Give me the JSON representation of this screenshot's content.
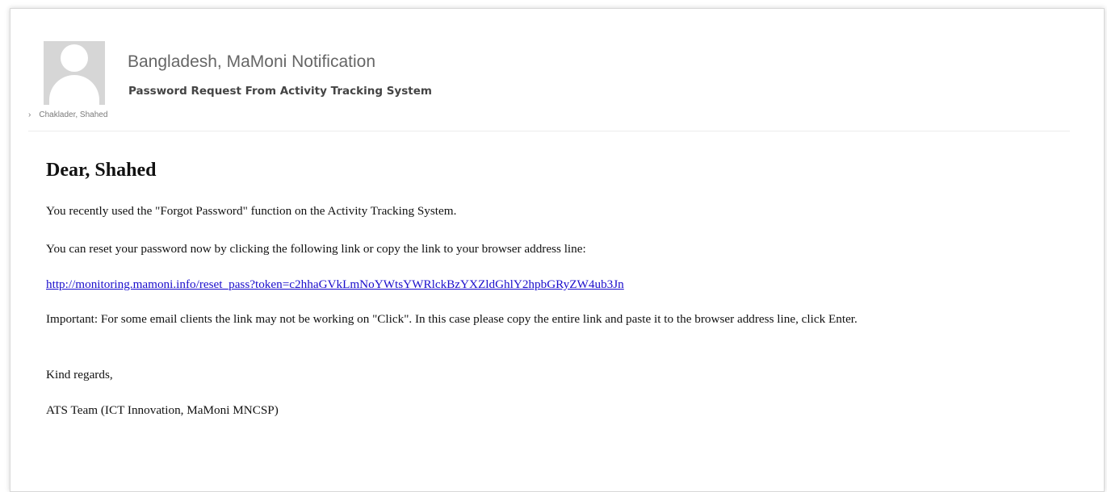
{
  "email": {
    "sender_name": "Bangladesh, MaMoni Notification",
    "subject": "Password Request From Activity Tracking System",
    "recipient": "Chaklader, Shahed",
    "greeting": "Dear, Shahed",
    "paragraphs": [
      "You recently used the \"Forgot Password\" function on the Activity Tracking System.",
      "You can reset your password now by clicking the following link or copy the link to your browser address line:"
    ],
    "reset_link": "http://monitoring.mamoni.info/reset_pass?token=c2hhaGVkLmNoYWtsYWRlckBzYXZldGhlY2hpbGRyZW4ub3Jn",
    "important_note": "Important: For some email clients the link may not be working on \"Click\". In this case please copy the entire link and paste it to the browser address line, click Enter.",
    "closing": "Kind regards,",
    "signature": "ATS Team (ICT Innovation, MaMoni MNCSP)"
  },
  "icons": {
    "avatar": "person-placeholder-icon",
    "recipient_prefix": "chevron-right-icon"
  },
  "colors": {
    "link": "#1a0dcc",
    "avatar_bg": "#d6d6d6"
  }
}
